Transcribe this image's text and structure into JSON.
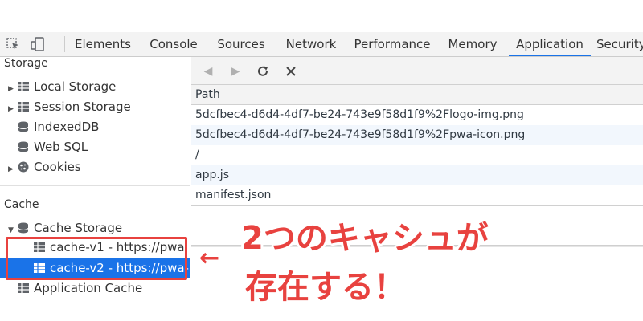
{
  "devtools": {
    "tabs": [
      "Elements",
      "Console",
      "Sources",
      "Network",
      "Performance",
      "Memory",
      "Application",
      "Security"
    ],
    "active_tab": "Application"
  },
  "sidebar": {
    "storage_title": "Storage",
    "storage_items": [
      "Local Storage",
      "Session Storage",
      "IndexedDB",
      "Web SQL",
      "Cookies"
    ],
    "cache_title": "Cache",
    "cache_storage_label": "Cache Storage",
    "caches": [
      "cache-v1 - https://pwa",
      "cache-v2 - https://pwa-"
    ],
    "selected_cache": "cache-v2 - https://pwa-",
    "app_cache_label": "Application Cache"
  },
  "toolbar": {
    "back_icon": "triangle-left-icon",
    "forward_icon": "triangle-right-icon",
    "refresh_icon": "refresh-icon",
    "clear_icon": "close-icon"
  },
  "table": {
    "column": "Path",
    "rows": [
      "5dcfbec4-d6d4-4df7-be24-743e9f58d1f9%2Flogo-img.png",
      "5dcfbec4-d6d4-4df7-be24-743e9f58d1f9%2Fpwa-icon.png",
      "/",
      "app.js",
      "manifest.json"
    ]
  },
  "annotation": {
    "arrow": "←",
    "line1": "2つのキャシュが",
    "line2": "存在する！"
  },
  "colors": {
    "accent": "#1a73e8",
    "annotation": "#e8423f"
  }
}
